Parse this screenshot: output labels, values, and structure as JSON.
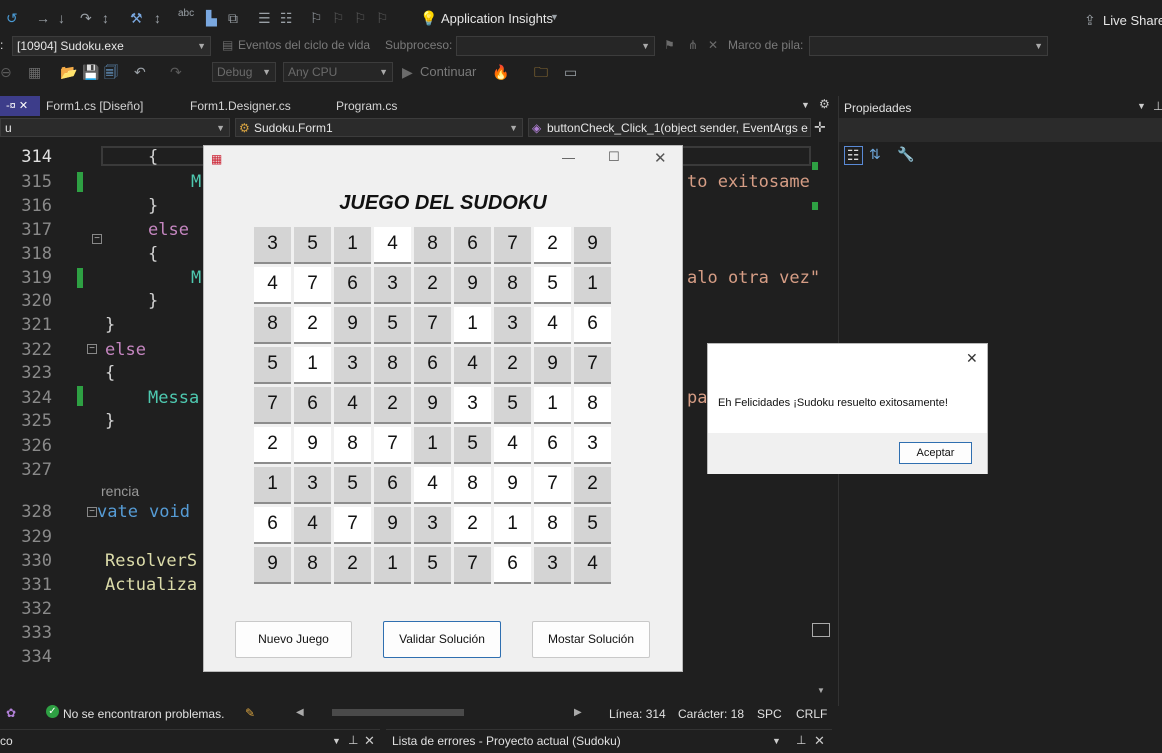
{
  "toolbar1": {
    "insights_label": "Application Insights",
    "live_share_label": "Live Share"
  },
  "toolbar2": {
    "process_prefix": ":",
    "process_value": "[10904] Sudoku.exe",
    "lifecycle_label": "Eventos del ciclo de vida",
    "subprocess_label": "Subproceso:",
    "stack_label": "Marco de pila:"
  },
  "toolbar3": {
    "config_value": "Debug",
    "platform_value": "Any CPU",
    "continue_label": "Continuar"
  },
  "tabs": [
    {
      "label": "Form1.cs [Diseño]"
    },
    {
      "label": "Form1.Designer.cs"
    },
    {
      "label": "Program.cs"
    }
  ],
  "nav": {
    "left_value": "u",
    "class_value": "Sudoku.Form1",
    "method_value": "buttonCheck_Click_1(object sender, EventArgs e"
  },
  "properties_panel": {
    "title": "Propiedades"
  },
  "editor": {
    "line_numbers": [
      "314",
      "315",
      "316",
      "317",
      "318",
      "319",
      "320",
      "321",
      "322",
      "323",
      "324",
      "325",
      "326",
      "327",
      "328",
      "329",
      "330",
      "331",
      "332",
      "333",
      "334"
    ],
    "code": {
      "l314": "{",
      "l315_pre": "M",
      "l315_post": "to exitosame",
      "l316": "}",
      "l317": "else",
      "l318": "{",
      "l319_pre": "M",
      "l319_post": "alo otra vez\"",
      "l320": "}",
      "l321": "}",
      "l322": "else",
      "l323": "{",
      "l324_pre": "Messa",
      "l324_post": "pa",
      "l325": "}",
      "ref_hint": "rencia",
      "l328a": "vate",
      "l328b": "void",
      "l330": "ResolverS",
      "l331": "Actualiza"
    }
  },
  "sudoku_window": {
    "title": "JUEGO DEL SUDOKU",
    "grid": [
      [
        3,
        5,
        1,
        4,
        8,
        6,
        7,
        2,
        9
      ],
      [
        4,
        7,
        6,
        3,
        2,
        9,
        8,
        5,
        1
      ],
      [
        8,
        2,
        9,
        5,
        7,
        1,
        3,
        4,
        6
      ],
      [
        5,
        1,
        3,
        8,
        6,
        4,
        2,
        9,
        7
      ],
      [
        7,
        6,
        4,
        2,
        9,
        3,
        5,
        1,
        8
      ],
      [
        2,
        9,
        8,
        7,
        1,
        5,
        4,
        6,
        3
      ],
      [
        1,
        3,
        5,
        6,
        4,
        8,
        9,
        7,
        2
      ],
      [
        6,
        4,
        7,
        9,
        3,
        2,
        1,
        8,
        5
      ],
      [
        9,
        8,
        2,
        1,
        5,
        7,
        6,
        3,
        4
      ]
    ],
    "gray_mask": [
      [
        1,
        1,
        1,
        0,
        1,
        1,
        1,
        0,
        1
      ],
      [
        0,
        0,
        1,
        1,
        1,
        1,
        1,
        0,
        1
      ],
      [
        1,
        0,
        1,
        1,
        1,
        0,
        1,
        0,
        0
      ],
      [
        1,
        0,
        1,
        1,
        1,
        1,
        1,
        1,
        1
      ],
      [
        1,
        1,
        1,
        1,
        1,
        0,
        1,
        0,
        0
      ],
      [
        0,
        0,
        0,
        0,
        1,
        1,
        0,
        0,
        0
      ],
      [
        1,
        1,
        1,
        1,
        0,
        0,
        0,
        0,
        1
      ],
      [
        0,
        1,
        0,
        1,
        1,
        0,
        0,
        0,
        1
      ],
      [
        1,
        1,
        1,
        1,
        1,
        1,
        0,
        1,
        1
      ]
    ],
    "buttons": {
      "new_game": "Nuevo Juego",
      "validate": "Validar Solución",
      "show": "Mostar Solución"
    }
  },
  "message_box": {
    "text": "Eh Felicidades ¡Sudoku resuelto exitosamente!",
    "ok_label": "Aceptar"
  },
  "status_bar": {
    "problems": "No se encontraron problemas.",
    "line": "Línea: 314",
    "char": "Carácter: 18",
    "spc": "SPC",
    "crlf": "CRLF"
  },
  "bottom_panels": {
    "left_label": "co",
    "errors_label": "Lista de errores - Proyecto actual (Sudoku)"
  },
  "colors": {
    "accent": "#6f6fcf",
    "success": "#2ea043",
    "focus_border": "#2f6fb0"
  }
}
